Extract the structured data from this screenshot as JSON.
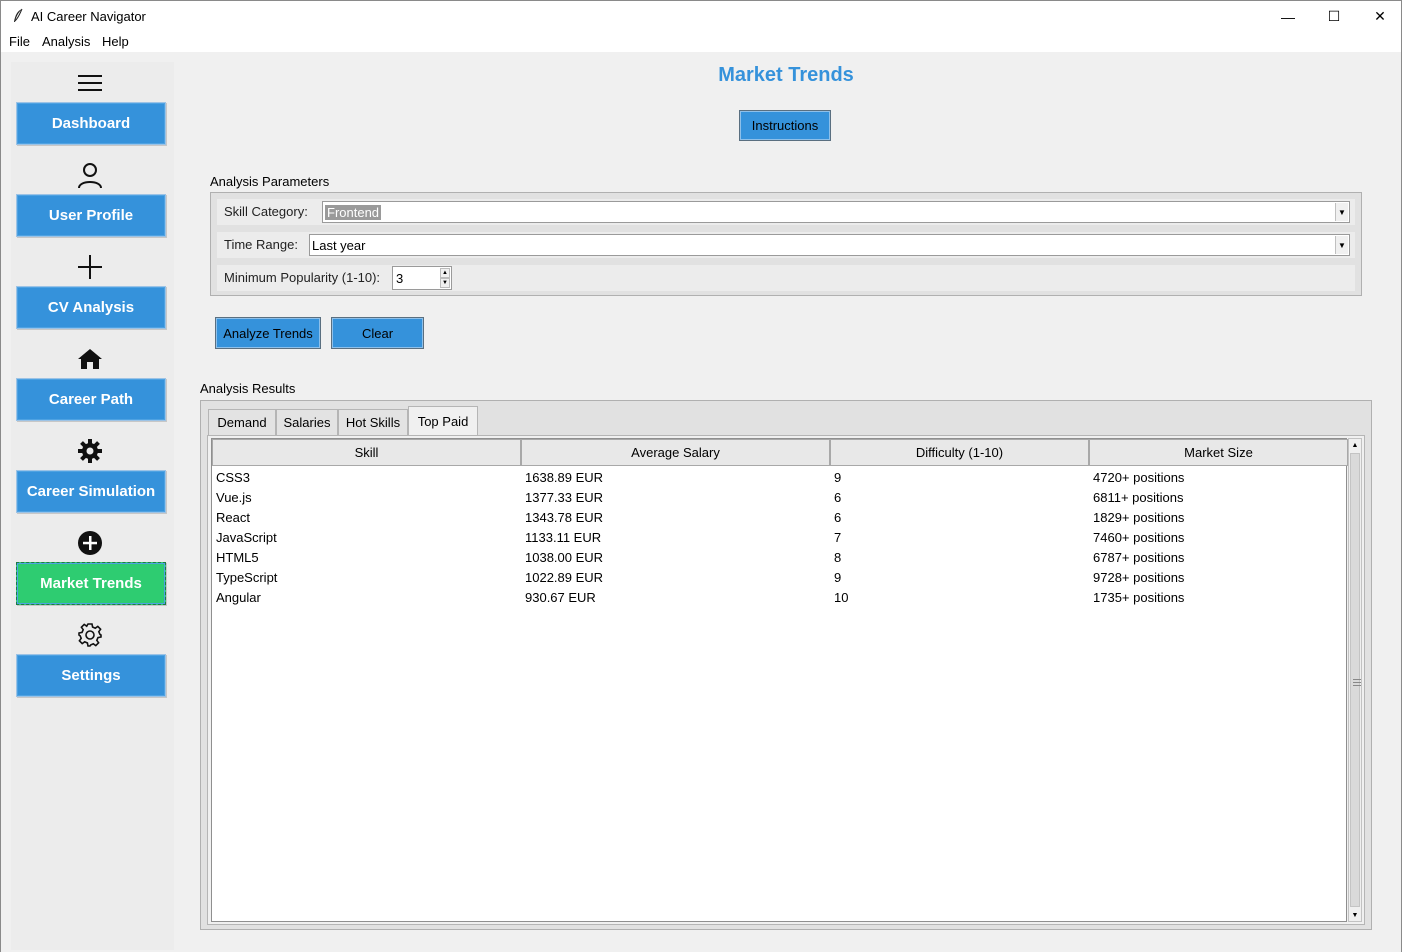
{
  "window": {
    "title": "AI Career Navigator",
    "minimize": "—",
    "maximize": "☐",
    "close": "✕"
  },
  "menu": [
    "File",
    "Analysis",
    "Help"
  ],
  "sidebar": {
    "items": [
      {
        "label": "Dashboard",
        "icon": "hamburger-icon"
      },
      {
        "label": "User Profile",
        "icon": "user-icon"
      },
      {
        "label": "CV Analysis",
        "icon": "plus-icon"
      },
      {
        "label": "Career Path",
        "icon": "home-icon"
      },
      {
        "label": "Career Simulation",
        "icon": "gear-filled-icon"
      },
      {
        "label": "Market Trends",
        "icon": "plus-circle-icon",
        "active": true
      },
      {
        "label": "Settings",
        "icon": "gear-outline-icon"
      }
    ],
    "colors": {
      "button": "#3592db",
      "active": "#2ecc71"
    }
  },
  "main": {
    "title": "Market Trends",
    "instructions_label": "Instructions",
    "params": {
      "group_label": "Analysis Parameters",
      "skill_category_label": "Skill Category:",
      "skill_category_value": "Frontend",
      "time_range_label": "Time Range:",
      "time_range_value": "Last year",
      "min_popularity_label": "Minimum Popularity (1-10):",
      "min_popularity_value": "3"
    },
    "analyze_label": "Analyze Trends",
    "clear_label": "Clear",
    "results": {
      "group_label": "Analysis Results",
      "tabs": [
        "Demand",
        "Salaries",
        "Hot Skills",
        "Top Paid"
      ],
      "active_tab": "Top Paid",
      "columns": [
        "Skill",
        "Average Salary",
        "Difficulty (1-10)",
        "Market Size"
      ],
      "rows": [
        [
          "CSS3",
          "1638.89 EUR",
          "9",
          "4720+ positions"
        ],
        [
          "Vue.js",
          "1377.33 EUR",
          "6",
          "6811+ positions"
        ],
        [
          "React",
          "1343.78 EUR",
          "6",
          "1829+ positions"
        ],
        [
          "JavaScript",
          "1133.11 EUR",
          "7",
          "7460+ positions"
        ],
        [
          "HTML5",
          "1038.00 EUR",
          "8",
          "6787+ positions"
        ],
        [
          "TypeScript",
          "1022.89 EUR",
          "9",
          "9728+ positions"
        ],
        [
          "Angular",
          "930.67 EUR",
          "10",
          "1735+ positions"
        ]
      ]
    }
  }
}
